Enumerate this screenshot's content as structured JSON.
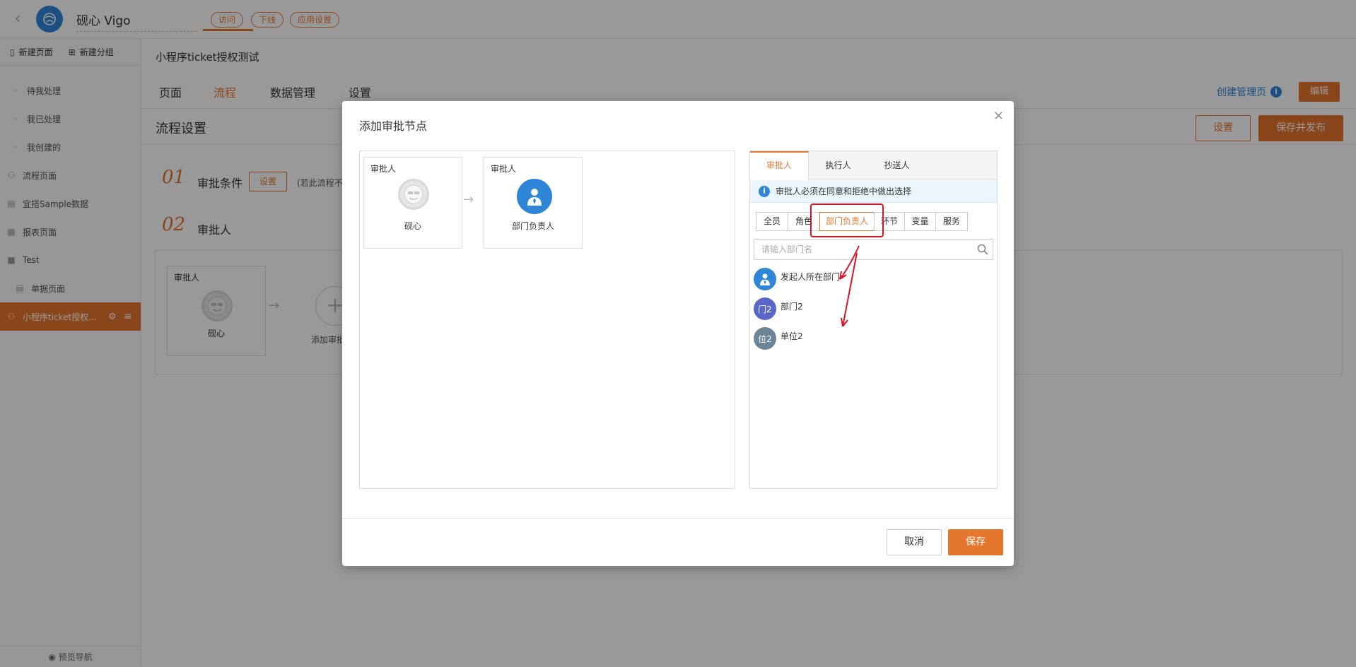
{
  "topbar": {
    "app_title": "砚心 Vigo",
    "pills": [
      "访问",
      "下线",
      "应用设置"
    ]
  },
  "sidebar": {
    "new_page": "新建页面",
    "new_group": "新建分组",
    "items": [
      {
        "label": "待我处理"
      },
      {
        "label": "我已处理"
      },
      {
        "label": "我创建的"
      },
      {
        "label": "流程页面"
      },
      {
        "label": "宜搭Sample数据"
      },
      {
        "label": "报表页面"
      },
      {
        "label": "Test"
      },
      {
        "label": "单据页面"
      },
      {
        "label": "小程序ticket授权..."
      }
    ],
    "footer": "预览导航"
  },
  "main": {
    "page_title": "小程序ticket授权测试",
    "tabs": [
      "页面",
      "流程",
      "数据管理",
      "设置"
    ],
    "active_tab": "流程",
    "create_admin": "创建管理页",
    "edit": "编辑",
    "flow_title": "流程设置",
    "settings_btn": "设置",
    "save_publish": "保存并发布",
    "step1_label": "审批条件",
    "step1_btn": "设置",
    "step1_note": "(若此流程不",
    "step2_label": "审批人",
    "node": {
      "caption": "审批人",
      "name": "砚心"
    },
    "add_label": "添加审批"
  },
  "modal": {
    "title": "添加审批节点",
    "close": "×",
    "nodes": [
      {
        "caption": "审批人",
        "name": "砚心"
      },
      {
        "caption": "审批人",
        "name": "部门负责人"
      }
    ],
    "tabs": [
      "审批人",
      "执行人",
      "抄送人"
    ],
    "info": "审批人必须在同意和拒绝中做出选择",
    "segments": [
      "全员",
      "角色",
      "部门负责人",
      "环节",
      "变量",
      "服务"
    ],
    "active_segment": "部门负责人",
    "search_placeholder": "请输入部门名",
    "departments": [
      {
        "avatar": "",
        "label": "发起人所在部门"
      },
      {
        "avatar": "门2",
        "label": "部门2"
      },
      {
        "avatar": "位2",
        "label": "单位2"
      }
    ],
    "cancel": "取消",
    "save": "保存"
  },
  "colors": {
    "accent": "#e5762e",
    "brand_blue": "#2f86d6",
    "annotation": "#d6152a"
  }
}
